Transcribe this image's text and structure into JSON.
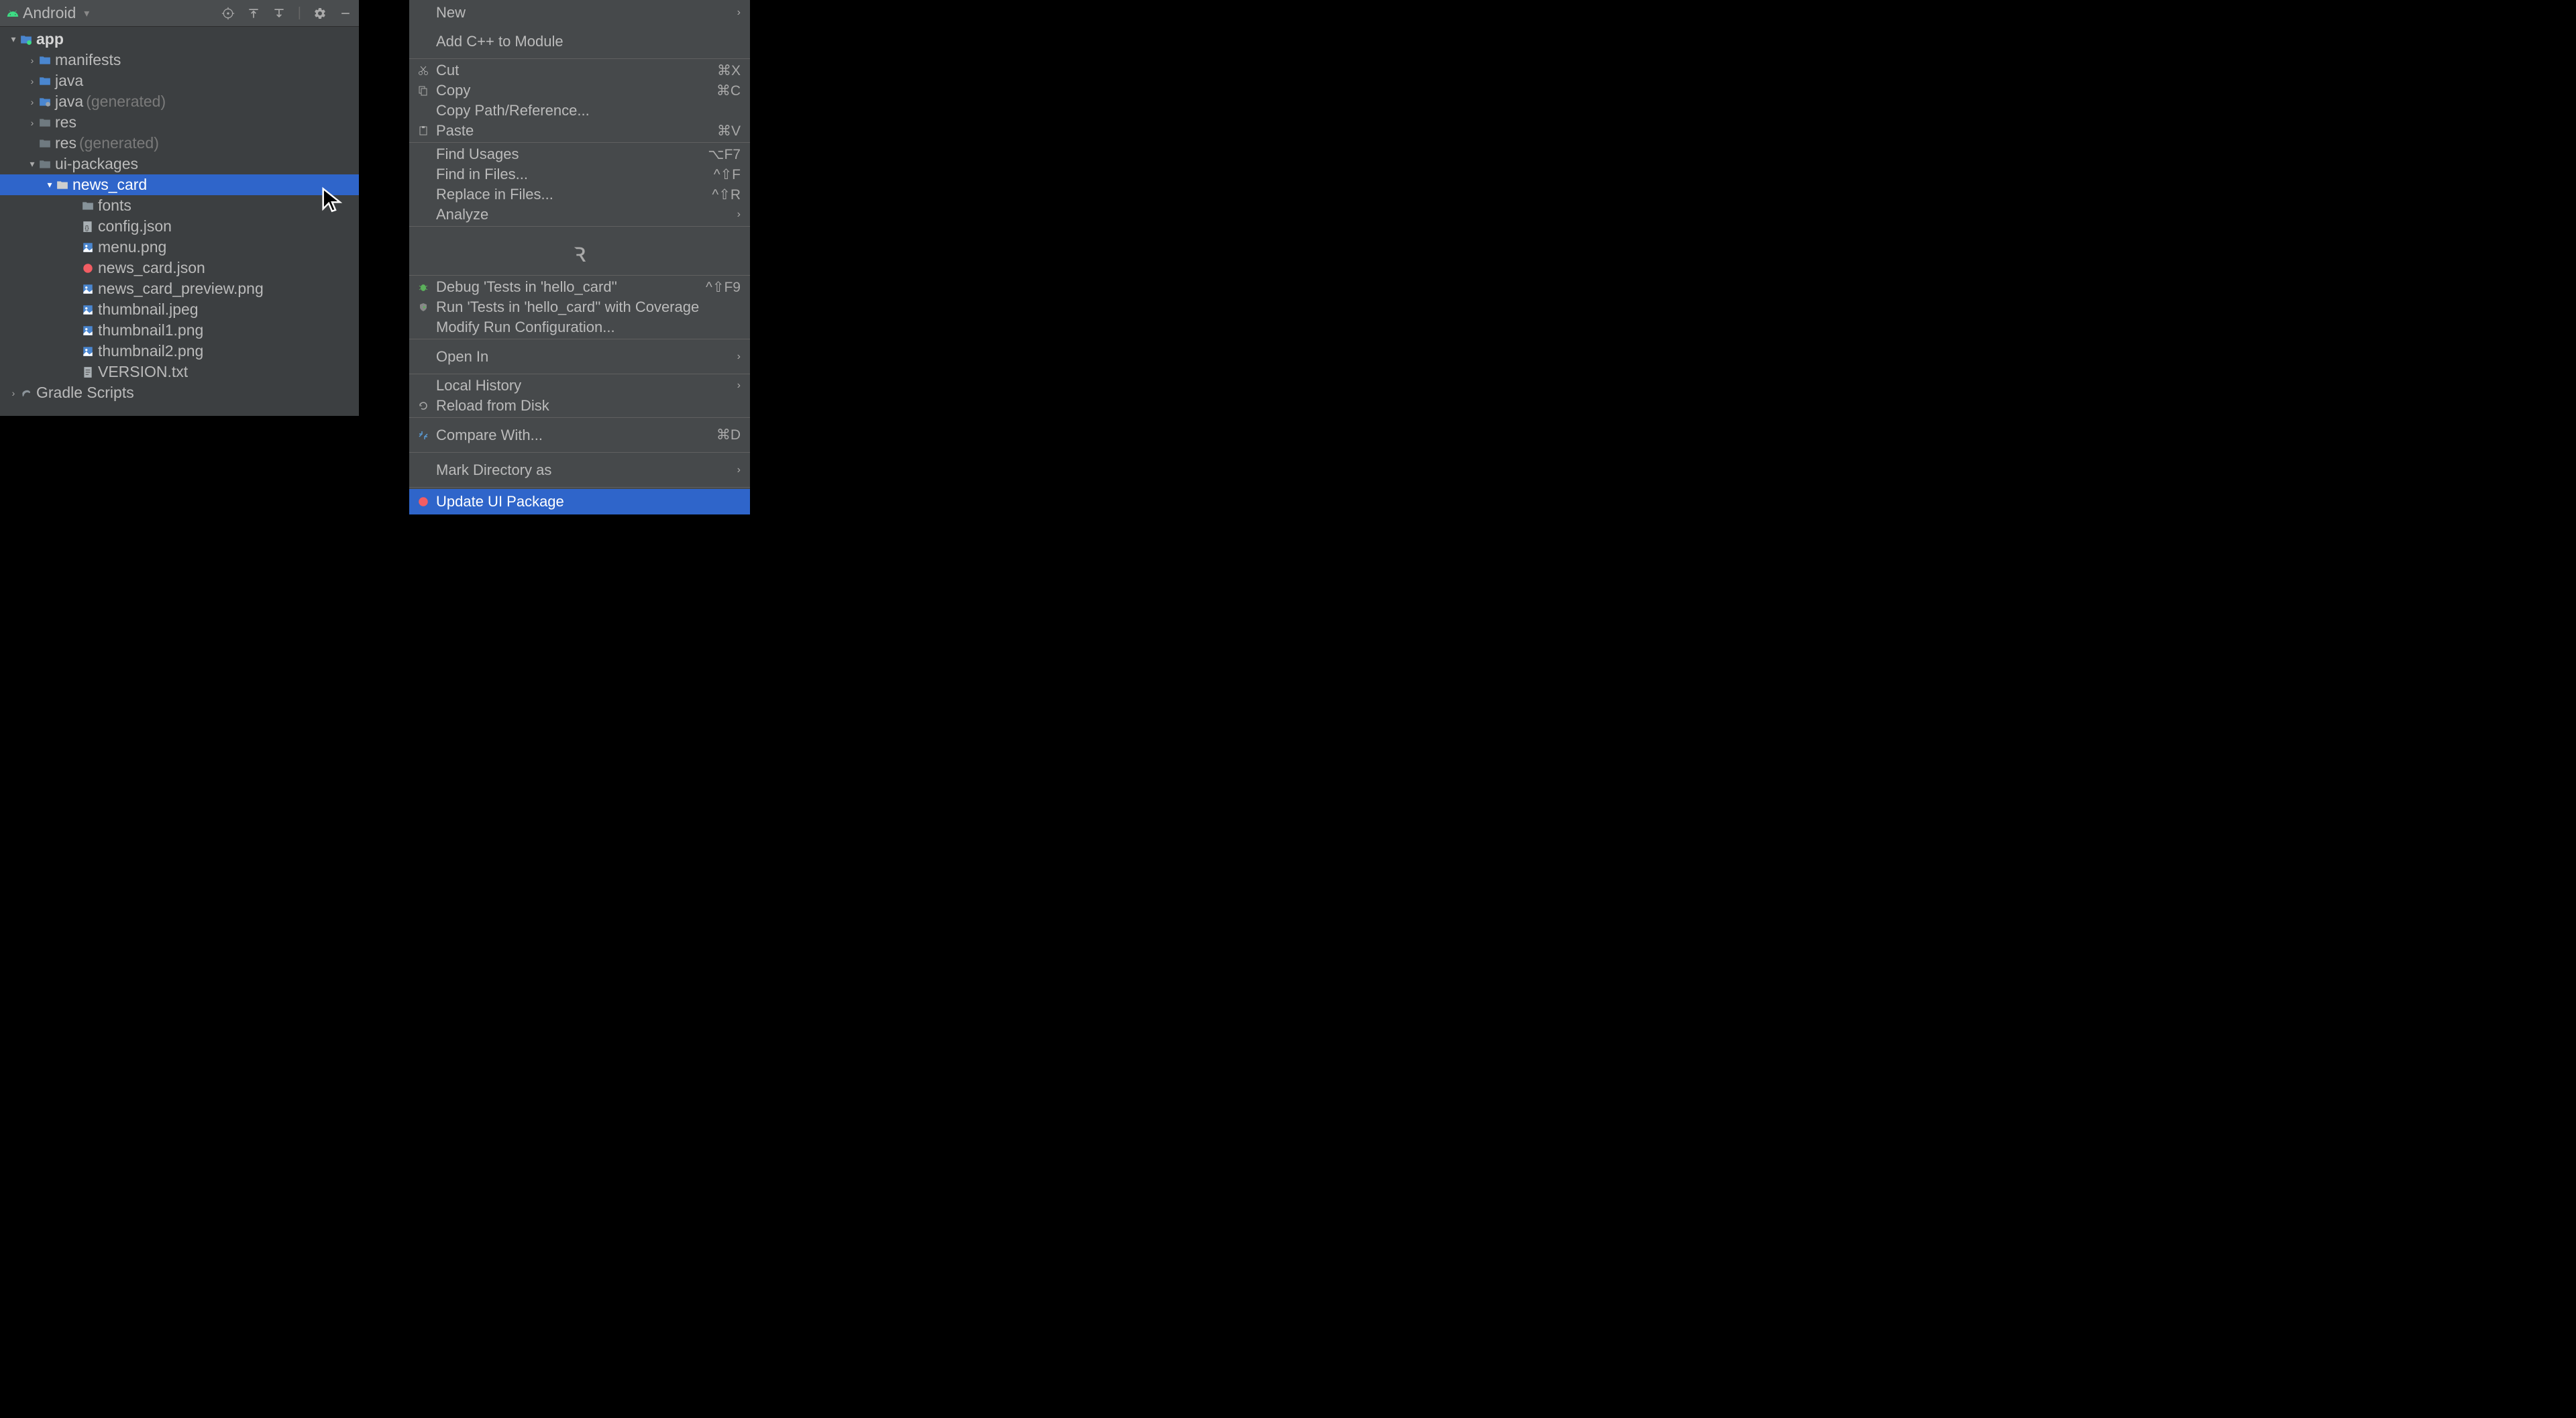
{
  "panel": {
    "title": "Android",
    "tree": {
      "app": "app",
      "manifests": "manifests",
      "java": "java",
      "java_gen": "java",
      "java_gen_hint": "(generated)",
      "res": "res",
      "res_gen": "res",
      "res_gen_hint": "(generated)",
      "ui_packages": "ui-packages",
      "news_card": "news_card",
      "fonts": "fonts",
      "config_json": "config.json",
      "menu_png": "menu.png",
      "news_card_json": "news_card.json",
      "news_card_preview_png": "news_card_preview.png",
      "thumbnail_jpeg": "thumbnail.jpeg",
      "thumbnail1_png": "thumbnail1.png",
      "thumbnail2_png": "thumbnail2.png",
      "version_txt": "VERSION.txt",
      "gradle_scripts": "Gradle Scripts"
    }
  },
  "menu": {
    "new": "New",
    "add_cpp": "Add C++ to Module",
    "cut": {
      "label": "Cut",
      "shortcut": "⌘X"
    },
    "copy": {
      "label": "Copy",
      "shortcut": "⌘C"
    },
    "copy_path": "Copy Path/Reference...",
    "paste": {
      "label": "Paste",
      "shortcut": "⌘V"
    },
    "find_usages": {
      "label": "Find Usages",
      "shortcut": "⌥F7"
    },
    "find_in_files": {
      "label": "Find in Files...",
      "shortcut": "^⇧F"
    },
    "replace_in_files": {
      "label": "Replace in Files...",
      "shortcut": "^⇧R"
    },
    "analyze": "Analyze",
    "debug_tests": {
      "label": "Debug 'Tests in 'hello_card''",
      "shortcut": "^⇧F9"
    },
    "run_coverage": "Run 'Tests in 'hello_card'' with Coverage",
    "modify_run": "Modify Run Configuration...",
    "open_in": "Open In",
    "local_history": "Local History",
    "reload_disk": "Reload from Disk",
    "compare_with": {
      "label": "Compare With...",
      "shortcut": "⌘D"
    },
    "mark_directory": "Mark Directory as",
    "update_ui_package": "Update UI Package"
  }
}
